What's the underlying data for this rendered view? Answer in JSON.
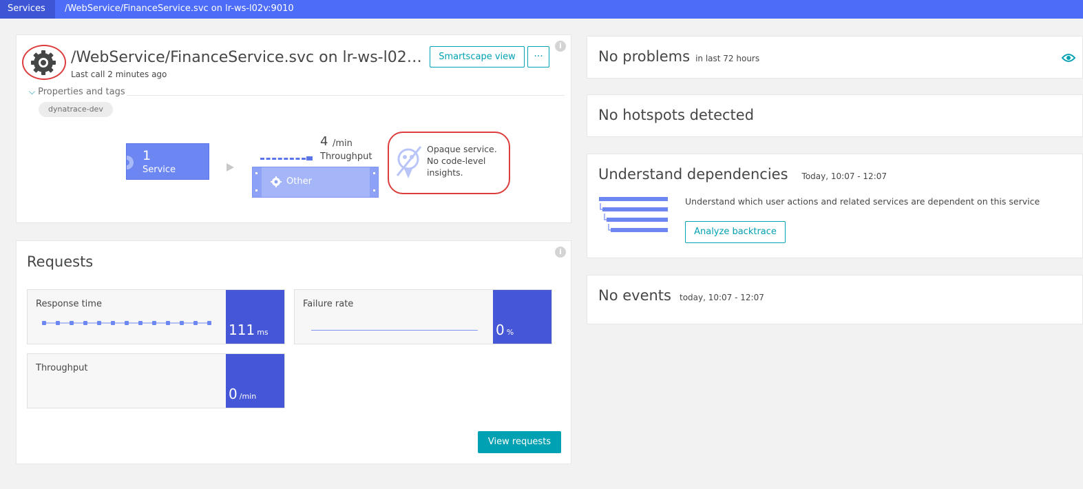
{
  "breadcrumb": {
    "services": "Services",
    "current": "/WebService/FinanceService.svc on lr-ws-l02v:9010"
  },
  "service": {
    "title": "/WebService/FinanceService.svc on lr-ws-l02v:9010",
    "last_call": "Last call 2 minutes ago",
    "smartscape_label": "Smartscape view",
    "more_label": "···",
    "properties_label": "Properties and tags",
    "tag": "dynatrace-dev"
  },
  "flow": {
    "service_count": "1",
    "service_label": "Service",
    "throughput_value": "4",
    "throughput_unit": "/min",
    "throughput_label": "Throughput",
    "other_label": "Other",
    "opaque_text": "Opaque service. No code-level insights."
  },
  "requests": {
    "title": "Requests",
    "tiles": {
      "response_time": {
        "label": "Response time",
        "value": "111",
        "unit": "ms"
      },
      "failure_rate": {
        "label": "Failure rate",
        "value": "0",
        "unit": "%"
      },
      "throughput": {
        "label": "Throughput",
        "value": "0",
        "unit": "/min"
      }
    },
    "view_label": "View requests"
  },
  "problems": {
    "title": "No problems",
    "sub": "in last 72 hours"
  },
  "hotspots": {
    "title": "No hotspots detected"
  },
  "dependencies": {
    "title": "Understand dependencies",
    "sub": "Today, 10:07 - 12:07",
    "text": "Understand which user actions and related services are dependent on this service",
    "button": "Analyze backtrace"
  },
  "events": {
    "title": "No events",
    "sub": "today, 10:07 - 12:07"
  },
  "colors": {
    "topbar": "#4d6cf7",
    "accent": "#00a1b2",
    "tile_value": "#4556d6",
    "highlight": "#dc3c3c"
  }
}
